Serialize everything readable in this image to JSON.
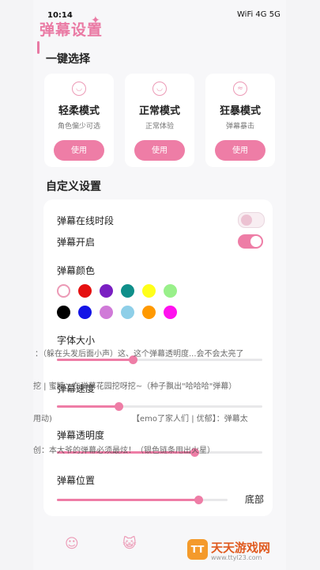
{
  "status_bar": {
    "time": "10:14",
    "icons": "WiFi 4G 5G"
  },
  "header": {
    "title": "弹幕设置",
    "sparkle": "✦"
  },
  "sections": {
    "quick": "一键选择",
    "custom": "自定义设置"
  },
  "modes": [
    {
      "title": "轻柔模式",
      "desc": "角色偏少可选",
      "button": "使用"
    },
    {
      "title": "正常模式",
      "desc": "正常体验",
      "button": "使用"
    },
    {
      "title": "狂暴模式",
      "desc": "弹幕暴击",
      "button": "使用"
    }
  ],
  "settings": {
    "online_period": "弹幕在线时段",
    "enabled": "弹幕开启",
    "color": "弹幕颜色",
    "font_size": "字体大小",
    "speed": "弹幕速度",
    "opacity": "弹幕透明度",
    "position": "弹幕位置",
    "position_value": "底部"
  },
  "toggles": {
    "online_period": false,
    "enabled": true
  },
  "colors": [
    "#ffffff",
    "#e51010",
    "#7a1fc2",
    "#0f8f8a",
    "#ffff1a",
    "#99f08a",
    "#000000",
    "#1414e6",
    "#d07ad8",
    "#8ecfe8",
    "#ff9900",
    "#ff11ee"
  ],
  "sliders": {
    "font_size": 0.37,
    "speed": 0.3,
    "opacity": 0.67,
    "position": 0.83
  },
  "danmaku": [
    "：（躲在头发后面小声）这、这个弹幕透明度...会不会太亮了",
    "挖 | 蜜糖：在弹幕花园挖呀挖~（种子飘出\"哈哈哈\"弹幕）",
    "用动)",
    "【emo了家人们 | 优郁】：弹幕太",
    "创：本大爷的弹幕必须最炫！（银色链条甩出火星）"
  ],
  "watermark": {
    "logo": "TT",
    "text": "天天游戏网",
    "url": "www.ttyl23.com"
  },
  "tabs": {
    "left": "☺",
    "right": "😺"
  }
}
